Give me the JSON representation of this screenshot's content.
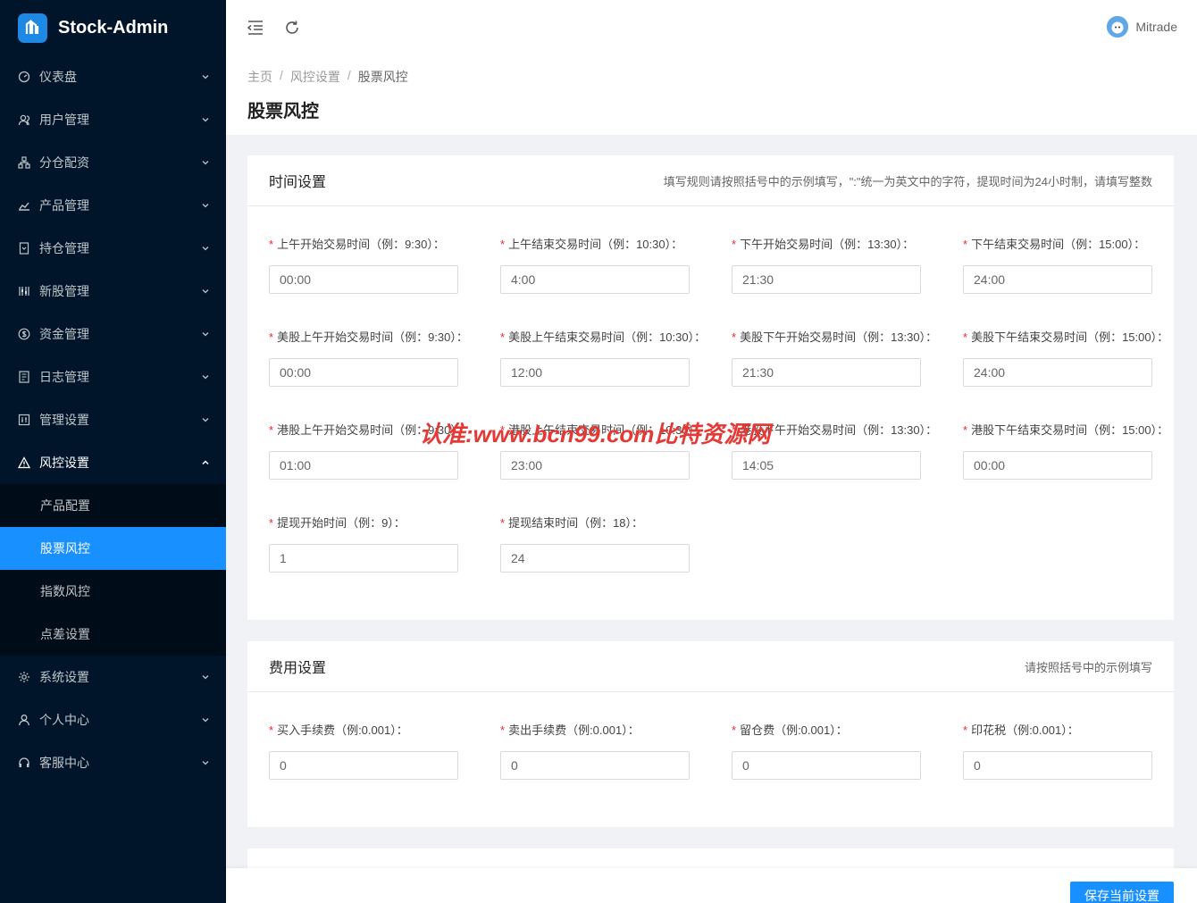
{
  "app": {
    "name": "Stock-Admin"
  },
  "sidebar": {
    "items": [
      {
        "label": "仪表盘",
        "icon": "dashboard-icon"
      },
      {
        "label": "用户管理",
        "icon": "users-icon"
      },
      {
        "label": "分仓配资",
        "icon": "cluster-icon"
      },
      {
        "label": "产品管理",
        "icon": "chart-icon"
      },
      {
        "label": "持仓管理",
        "icon": "file-icon"
      },
      {
        "label": "新股管理",
        "icon": "sliders-icon"
      },
      {
        "label": "资金管理",
        "icon": "dollar-icon"
      },
      {
        "label": "日志管理",
        "icon": "log-icon"
      },
      {
        "label": "管理设置",
        "icon": "settings-grid-icon"
      },
      {
        "label": "风控设置",
        "icon": "warning-icon"
      },
      {
        "label": "系统设置",
        "icon": "gear-icon"
      },
      {
        "label": "个人中心",
        "icon": "user-icon"
      },
      {
        "label": "客服中心",
        "icon": "headset-icon"
      }
    ],
    "submenu": [
      "产品配置",
      "股票风控",
      "指数风控",
      "点差设置"
    ]
  },
  "header": {
    "username": "Mitrade"
  },
  "breadcrumb": [
    "主页",
    "风控设置",
    "股票风控"
  ],
  "page_title": "股票风控",
  "time_card": {
    "title": "时间设置",
    "hint": "填写规则请按照括号中的示例填写，\":\"统一为英文中的字符，提现时间为24小时制，请填写整数",
    "fields": [
      {
        "label": "上午开始交易时间（例：9:30）：",
        "value": "00:00"
      },
      {
        "label": "上午结束交易时间（例：10:30）：",
        "value": "4:00"
      },
      {
        "label": "下午开始交易时间（例：13:30）：",
        "value": "21:30"
      },
      {
        "label": "下午结束交易时间（例：15:00）：",
        "value": "24:00"
      },
      {
        "label": "美股上午开始交易时间（例：9:30）：",
        "value": "00:00"
      },
      {
        "label": "美股上午结束交易时间（例：10:30）：",
        "value": "12:00"
      },
      {
        "label": "美股下午开始交易时间（例：13:30）：",
        "value": "21:30"
      },
      {
        "label": "美股下午结束交易时间（例：15:00）：",
        "value": "24:00"
      },
      {
        "label": "港股上午开始交易时间（例：9:30）：",
        "value": "01:00"
      },
      {
        "label": "港股上午结束交易时间（例：10:30）：",
        "value": "23:00"
      },
      {
        "label": "港股下午开始交易时间（例：13:30）：",
        "value": "14:05"
      },
      {
        "label": "港股下午结束交易时间（例：15:00）：",
        "value": "00:00"
      },
      {
        "label": "提现开始时间（例：9）：",
        "value": "1"
      },
      {
        "label": "提现结束时间（例：18）：",
        "value": "24"
      }
    ]
  },
  "fee_card": {
    "title": "费用设置",
    "hint": "请按照括号中的示例填写",
    "fields": [
      {
        "label": "买入手续费（例:0.001）：",
        "value": "0"
      },
      {
        "label": "卖出手续费（例:0.001）：",
        "value": "0"
      },
      {
        "label": "留仓费（例:0.001）：",
        "value": "0"
      },
      {
        "label": "印花税（例:0.001）：",
        "value": "0"
      }
    ]
  },
  "watermark": "认准:www.bcn99.com比特资源网",
  "save_button": "保存当前设置",
  "colors": {
    "sidebar_bg": "#001529",
    "active": "#1890ff",
    "required": "#f5222d"
  }
}
